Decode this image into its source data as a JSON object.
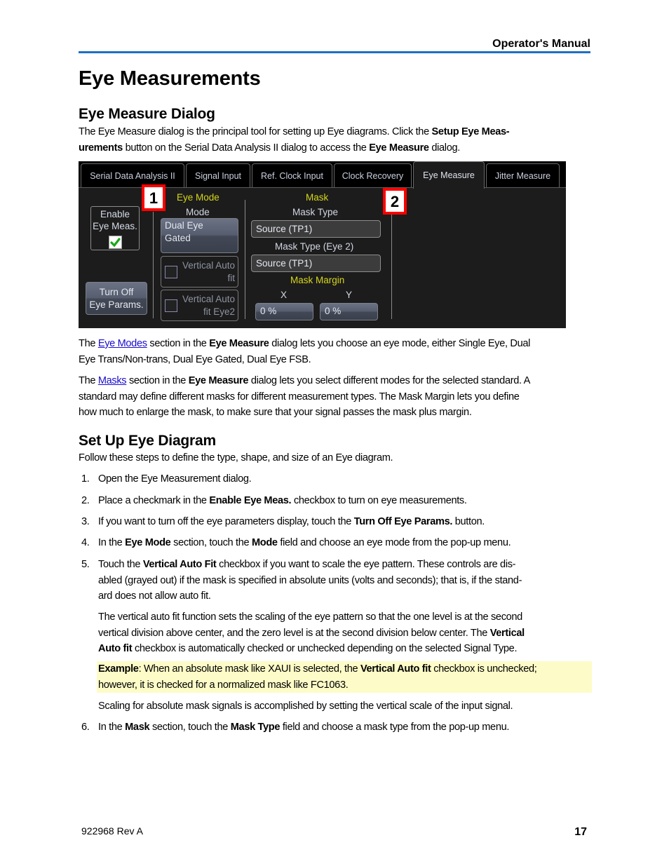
{
  "header": {
    "title": "Operator's Manual",
    "accent_color": "#1f6fc4"
  },
  "page_title": "Eye Measurements",
  "section1": {
    "heading": "Eye Measure Dialog",
    "intro": [
      {
        "t": "The Eye Measure dialog is the principal tool for setting up Eye diagrams. Click the "
      },
      {
        "t": "Setup Eye Meas-",
        "b": true
      }
    ],
    "intro_line2": [
      {
        "t": "urements",
        "b": true
      },
      {
        "t": " button on the Serial Data Analysis II dialog to access the "
      },
      {
        "t": "Eye Measure",
        "b": true
      },
      {
        "t": " dialog."
      }
    ]
  },
  "dialog": {
    "tabs": [
      {
        "label": "Serial Data Analysis II",
        "active": false
      },
      {
        "label": "Signal Input",
        "active": false
      },
      {
        "label": "Ref. Clock Input",
        "active": false
      },
      {
        "label": "Clock Recovery",
        "active": false
      },
      {
        "label": "Eye Measure",
        "active": true
      },
      {
        "label": "Jitter Measure",
        "active": false
      }
    ],
    "enable_eye_meas": {
      "label_line1": "Enable",
      "label_line2": "Eye Meas.",
      "checked": true
    },
    "turn_off_button": {
      "line1": "Turn Off",
      "line2": "Eye Params."
    },
    "eye_mode": {
      "section_label": "Eye Mode",
      "mode_label": "Mode",
      "mode_value_line1": "Dual Eye",
      "mode_value_line2": "Gated",
      "vertical_auto_fit": {
        "line1": "Vertical Auto",
        "line2": "fit",
        "checked": false,
        "disabled": true
      },
      "vertical_auto_fit_eye2": {
        "line1": "Vertical Auto",
        "line2": "fit Eye2",
        "checked": false,
        "disabled": true
      }
    },
    "mask": {
      "section_label": "Mask",
      "mask_type_label": "Mask Type",
      "mask_type_value": "Source (TP1)",
      "mask_type_eye2_label": "Mask Type (Eye 2)",
      "mask_type_eye2_value": "Source (TP1)",
      "margin_label": "Mask Margin",
      "x_label": "X",
      "y_label": "Y",
      "x_value": "0 %",
      "y_value": "0 %"
    },
    "callouts": [
      "1",
      "2"
    ]
  },
  "para_eye_modes": {
    "pre": "The ",
    "link": "Eye Modes",
    "mid": " section in the ",
    "bold": "Eye Measure",
    "post1": " dialog lets you choose an eye mode, either Single Eye, Dual",
    "line2": "Eye Trans/Non-trans, Dual Eye Gated, Dual Eye FSB."
  },
  "para_masks": {
    "pre": "The ",
    "link": "Masks",
    "mid": " section in the ",
    "bold": "Eye Measure",
    "post1": " dialog lets you select different modes for the selected standard. A",
    "line2": "standard may define different masks for different measurement types. The Mask Margin lets you define",
    "line3": "how much to enlarge the mask, to make sure that your signal passes the mask plus margin."
  },
  "section2": {
    "heading": "Set Up Eye Diagram",
    "intro": "Follow these steps to define the type, shape, and size of an Eye diagram."
  },
  "steps": [
    {
      "num": "1.",
      "parts": [
        {
          "t": "Open the Eye Measurement dialog."
        }
      ]
    },
    {
      "num": "2.",
      "parts": [
        {
          "t": "Place a checkmark in the "
        },
        {
          "t": "Enable Eye Meas.",
          "b": true
        },
        {
          "t": " checkbox to turn on eye measurements."
        }
      ]
    },
    {
      "num": "3.",
      "parts": [
        {
          "t": "If you want to turn off the eye parameters display, touch the "
        },
        {
          "t": "Turn Off Eye Params.",
          "b": true
        },
        {
          "t": " button."
        }
      ]
    },
    {
      "num": "4.",
      "parts": [
        {
          "t": "In the "
        },
        {
          "t": "Eye Mode",
          "b": true
        },
        {
          "t": " section, touch the "
        },
        {
          "t": "Mode",
          "b": true
        },
        {
          "t": " field and choose an eye mode from the pop-up menu."
        }
      ]
    },
    {
      "num": "5.",
      "parts": [
        {
          "t": "Touch the "
        },
        {
          "t": "Vertical Auto Fit",
          "b": true
        },
        {
          "t": " checkbox if you want to scale the eye pattern. These controls are dis-"
        }
      ],
      "line2": "abled (grayed out) if the mask is specified in absolute units (volts and seconds); that is, if the stand-",
      "line3": "ard does not allow auto fit."
    },
    {
      "num": "6.",
      "parts": [
        {
          "t": "In the "
        },
        {
          "t": "Mask",
          "b": true
        },
        {
          "t": " section, touch the "
        },
        {
          "t": "Mask Type",
          "b": true
        },
        {
          "t": " field and choose a mask type from the pop-up menu."
        }
      ]
    }
  ],
  "step5_detail": {
    "line1": "The vertical auto fit function sets the scaling of the eye pattern so that the one level is at the second",
    "line2_pre": "vertical division above center, and the zero level is at the second division below center. The ",
    "line2_bold": "Vertical",
    "line3_bold": "Auto fit",
    "line3_post": " checkbox is automatically checked or unchecked depending on the selected Signal Type."
  },
  "example": {
    "label": "Example",
    "pre": ": When an absolute mask like XAUI is selected, the ",
    "bold": "Vertical Auto fit",
    "post": " checkbox is unchecked;",
    "line2": "however, it is checked for a normalized mask like FC1063.",
    "highlight_color": "#fdfcc8"
  },
  "scaling_note": "Scaling for absolute mask signals is accomplished by setting the vertical scale of the input signal.",
  "footer": {
    "doc_number": "922968 Rev A",
    "page_number": "17"
  }
}
